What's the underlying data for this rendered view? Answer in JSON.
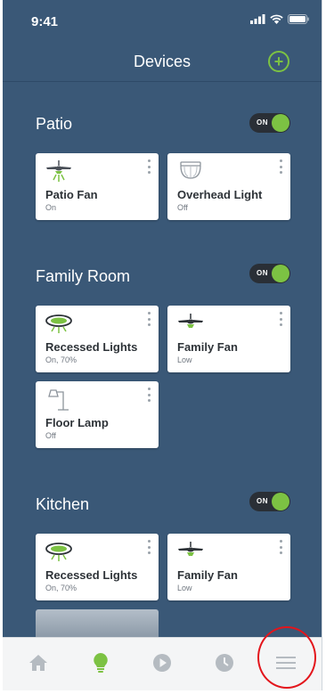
{
  "status_bar": {
    "time": "9:41"
  },
  "header": {
    "title": "Devices"
  },
  "sections": [
    {
      "title": "Patio",
      "toggle_label": "ON",
      "devices": [
        {
          "name": "Patio Fan",
          "status": "On",
          "icon": "ceiling-fan-on-icon"
        },
        {
          "name": "Overhead Light",
          "status": "Off",
          "icon": "dome-light-icon"
        }
      ]
    },
    {
      "title": "Family Room",
      "toggle_label": "ON",
      "devices": [
        {
          "name": "Recessed Lights",
          "status": "On, 70%",
          "icon": "recessed-light-icon"
        },
        {
          "name": "Family Fan",
          "status": "Low",
          "icon": "ceiling-fan-icon"
        },
        {
          "name": "Floor Lamp",
          "status": "Off",
          "icon": "floor-lamp-icon"
        }
      ]
    },
    {
      "title": "Kitchen",
      "toggle_label": "ON",
      "devices": [
        {
          "name": "Recessed Lights",
          "status": "On, 70%",
          "icon": "recessed-light-icon"
        },
        {
          "name": "Family Fan",
          "status": "Low",
          "icon": "ceiling-fan-icon"
        }
      ]
    }
  ],
  "tab_bar": {
    "tabs": [
      {
        "name": "home",
        "icon": "home-icon",
        "active": false
      },
      {
        "name": "devices",
        "icon": "lightbulb-icon",
        "active": true
      },
      {
        "name": "scenes",
        "icon": "play-icon",
        "active": false
      },
      {
        "name": "schedules",
        "icon": "clock-icon",
        "active": false
      },
      {
        "name": "menu",
        "icon": "hamburger-menu-icon",
        "active": false
      }
    ]
  },
  "colors": {
    "background": "#3a5877",
    "accent": "#7cc243",
    "toggle_track": "#2a2f36",
    "annotation": "#e3151c"
  }
}
